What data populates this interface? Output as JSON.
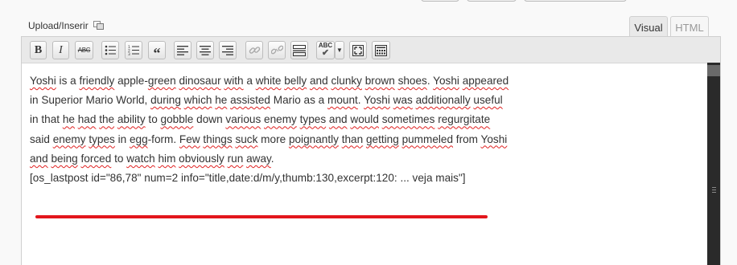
{
  "media": {
    "label": "Upload/Inserir",
    "icon": "media-library-icon"
  },
  "tabs": {
    "visual": "Visual",
    "html": "HTML"
  },
  "toolbar": {
    "bold": "B",
    "italic": "I",
    "strikethrough": "ABC",
    "blockquote": "“",
    "spellcheck": "ABC",
    "dropdown_arrow": "▼"
  },
  "content": {
    "paragraph": [
      {
        "t": "Yoshi",
        "s": true
      },
      {
        "t": " is a ",
        "s": false
      },
      {
        "t": "friendly",
        "s": true
      },
      {
        "t": " apple-",
        "s": false
      },
      {
        "t": "green",
        "s": true
      },
      {
        "t": " ",
        "s": false
      },
      {
        "t": "dinosaur",
        "s": true
      },
      {
        "t": " ",
        "s": false
      },
      {
        "t": "with",
        "s": true
      },
      {
        "t": " a ",
        "s": false
      },
      {
        "t": "white",
        "s": true
      },
      {
        "t": " ",
        "s": false
      },
      {
        "t": "belly",
        "s": true
      },
      {
        "t": " ",
        "s": false
      },
      {
        "t": "and",
        "s": true
      },
      {
        "t": " ",
        "s": false
      },
      {
        "t": "clunky",
        "s": true
      },
      {
        "t": " ",
        "s": false
      },
      {
        "t": "brown",
        "s": true
      },
      {
        "t": " ",
        "s": false
      },
      {
        "t": "shoes",
        "s": true
      },
      {
        "t": ". ",
        "s": false
      },
      {
        "t": "Yoshi",
        "s": true
      },
      {
        "t": " ",
        "s": false
      },
      {
        "t": "appeared",
        "s": true
      },
      {
        "t": " in Superior Mario World, ",
        "s": false
      },
      {
        "t": "during",
        "s": true
      },
      {
        "t": " ",
        "s": false
      },
      {
        "t": "which",
        "s": true
      },
      {
        "t": " ",
        "s": false
      },
      {
        "t": "he",
        "s": true
      },
      {
        "t": " ",
        "s": false
      },
      {
        "t": "assisted",
        "s": true
      },
      {
        "t": " Mario as a ",
        "s": false
      },
      {
        "t": "mount",
        "s": true
      },
      {
        "t": ". ",
        "s": false
      },
      {
        "t": "Yoshi",
        "s": true
      },
      {
        "t": " ",
        "s": false
      },
      {
        "t": "was",
        "s": true
      },
      {
        "t": " ",
        "s": false
      },
      {
        "t": "additionally",
        "s": true
      },
      {
        "t": " ",
        "s": false
      },
      {
        "t": "useful",
        "s": true
      },
      {
        "t": " in that ",
        "s": false
      },
      {
        "t": "he",
        "s": true
      },
      {
        "t": " ",
        "s": false
      },
      {
        "t": "had",
        "s": true
      },
      {
        "t": " ",
        "s": false
      },
      {
        "t": "the",
        "s": true
      },
      {
        "t": " ",
        "s": false
      },
      {
        "t": "ability",
        "s": true
      },
      {
        "t": " to ",
        "s": false
      },
      {
        "t": "gobble",
        "s": true
      },
      {
        "t": " down ",
        "s": false
      },
      {
        "t": "various",
        "s": true
      },
      {
        "t": " ",
        "s": false
      },
      {
        "t": "enemy",
        "s": true
      },
      {
        "t": " ",
        "s": false
      },
      {
        "t": "types",
        "s": true
      },
      {
        "t": " ",
        "s": false
      },
      {
        "t": "and",
        "s": true
      },
      {
        "t": " ",
        "s": false
      },
      {
        "t": "would",
        "s": true
      },
      {
        "t": " ",
        "s": false
      },
      {
        "t": "sometimes",
        "s": true
      },
      {
        "t": " ",
        "s": false
      },
      {
        "t": "regurgitate",
        "s": true
      },
      {
        "t": " said ",
        "s": false
      },
      {
        "t": "enemy",
        "s": true
      },
      {
        "t": " ",
        "s": false
      },
      {
        "t": "types",
        "s": true
      },
      {
        "t": " in ",
        "s": false
      },
      {
        "t": "egg",
        "s": true
      },
      {
        "t": "-form. ",
        "s": false
      },
      {
        "t": "Few",
        "s": true
      },
      {
        "t": " ",
        "s": false
      },
      {
        "t": "things",
        "s": true
      },
      {
        "t": " ",
        "s": false
      },
      {
        "t": "suck",
        "s": true
      },
      {
        "t": " more ",
        "s": false
      },
      {
        "t": "poignantly",
        "s": true
      },
      {
        "t": " ",
        "s": false
      },
      {
        "t": "than",
        "s": true
      },
      {
        "t": " ",
        "s": false
      },
      {
        "t": "getting",
        "s": true
      },
      {
        "t": " ",
        "s": false
      },
      {
        "t": "pummeled",
        "s": true
      },
      {
        "t": " from ",
        "s": false
      },
      {
        "t": "Yoshi",
        "s": true
      },
      {
        "t": " ",
        "s": false
      },
      {
        "t": "and",
        "s": true
      },
      {
        "t": " ",
        "s": false
      },
      {
        "t": "being",
        "s": true
      },
      {
        "t": " ",
        "s": false
      },
      {
        "t": "forced",
        "s": true
      },
      {
        "t": " to ",
        "s": false
      },
      {
        "t": "watch",
        "s": true
      },
      {
        "t": " ",
        "s": false
      },
      {
        "t": "him",
        "s": true
      },
      {
        "t": " ",
        "s": false
      },
      {
        "t": "obviously",
        "s": true
      },
      {
        "t": " ",
        "s": false
      },
      {
        "t": "run",
        "s": true
      },
      {
        "t": " ",
        "s": false
      },
      {
        "t": "away",
        "s": true
      },
      {
        "t": ".",
        "s": false
      }
    ],
    "shortcode": "[os_lastpost id=\"86,78\" num=2 info=\"title,date:d/m/y,thumb:130,excerpt:120: ... veja mais\"]"
  },
  "colors": {
    "spellcheck_underline": "#e02020",
    "annotation": "#e3161c",
    "scrollbar": "#2a2a2a"
  }
}
